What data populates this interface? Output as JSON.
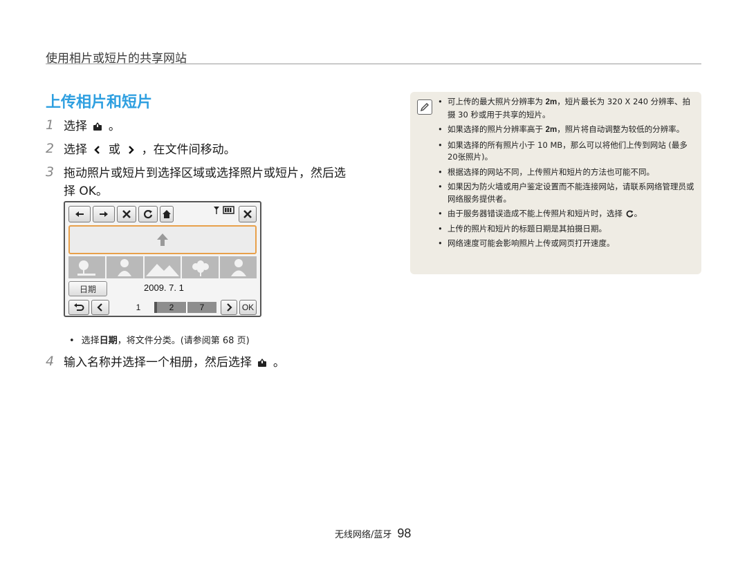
{
  "header": {
    "title": "使用相片或短片的共享网站"
  },
  "section": {
    "title": "上传相片和短片"
  },
  "steps": [
    {
      "num": "1",
      "text_before": "选择",
      "text_after": "。"
    },
    {
      "num": "2",
      "text_before": "选择",
      "or": "或",
      "text_after": "，在文件间移动。"
    },
    {
      "num": "3",
      "line1": "拖动照片或短片到选择区域或选择照片或短片，然后选",
      "line2": "择 OK。"
    },
    {
      "num": "4",
      "text_before": "输入名称并选择一个相册，然后选择",
      "text_after": "。"
    }
  ],
  "screen": {
    "date_button": "日期",
    "date_value": "2009. 7. 1",
    "timeline": [
      "1",
      "2",
      "7"
    ],
    "ok_label": "OK"
  },
  "bullet_main": {
    "prefix": "选择",
    "bold": "日期",
    "suffix": "，将文件分类。(请参阅第 68 页)"
  },
  "note": {
    "items": [
      {
        "a": "可上传的最大照片分辨率为",
        "b": "，短片最长为 320 X 240 分辨率、拍摄 30 秒或用于共享的短片。"
      },
      {
        "a": "如果选择的照片分辨率高于",
        "b": "，照片将自动调整为较低的分辨率。"
      },
      {
        "a": "如果选择的所有照片小于 10 MB，那么可以将他们上传到网站 (最多20张照片)。"
      },
      {
        "a": "根据选择的网站不同，上传照片和短片的方法也可能不同。"
      },
      {
        "a": "如果因为防火墙或用户鉴定设置而不能连接网站，请联系网络管理员或网络服务提供者。"
      },
      {
        "a": "由于服务器错误造成不能上传照片和短片时，选择",
        "b": "。"
      },
      {
        "a": "上传的照片和短片的标题日期是其拍摄日期。"
      },
      {
        "a": "网络速度可能会影响照片上传或网页打开速度。"
      }
    ],
    "resolution_label": "2m"
  },
  "footer": {
    "text": "无线网络/蓝牙",
    "page": "98"
  }
}
